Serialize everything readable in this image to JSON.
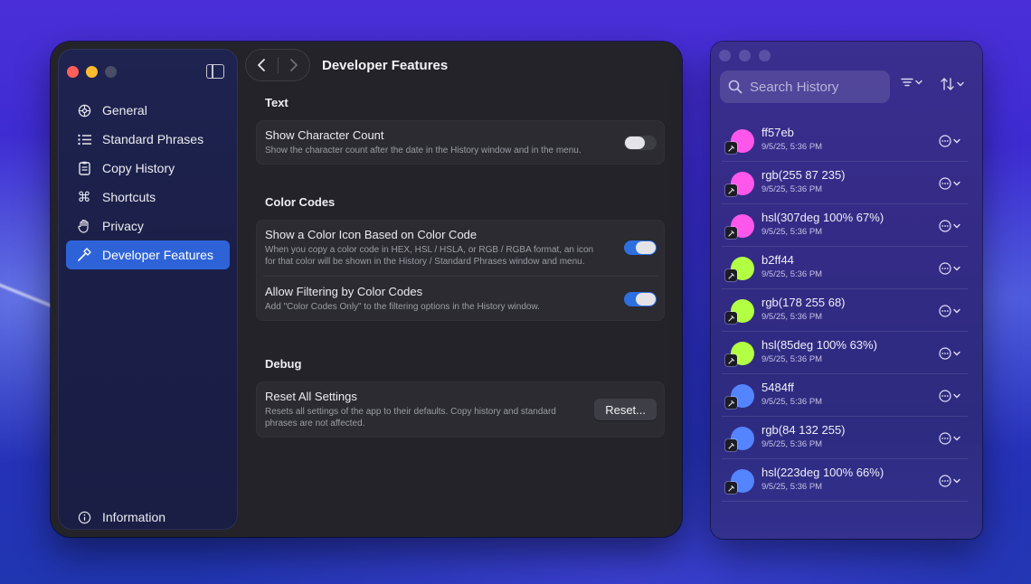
{
  "settings": {
    "sidebar": {
      "items": [
        {
          "label": "General",
          "icon": "gear-icon"
        },
        {
          "label": "Standard Phrases",
          "icon": "list-icon"
        },
        {
          "label": "Copy History",
          "icon": "clipboard-icon"
        },
        {
          "label": "Shortcuts",
          "icon": "command-icon"
        },
        {
          "label": "Privacy",
          "icon": "hand-icon"
        },
        {
          "label": "Developer Features",
          "icon": "hammer-icon",
          "active": true
        }
      ],
      "bottom_item": {
        "label": "Information",
        "icon": "info-icon"
      }
    },
    "title": "Developer Features",
    "sections": {
      "text": {
        "title": "Text",
        "show_char_count": {
          "title": "Show Character Count",
          "desc": "Show the character count after the date in the History window and in the menu.",
          "enabled": false
        }
      },
      "color_codes": {
        "title": "Color Codes",
        "color_icon": {
          "title": "Show a Color Icon Based on Color Code",
          "desc_line1": "When you copy a color code in HEX, HSL / HSLA, or RGB / RGBA format, an icon",
          "desc_line2": "for that color will be shown in the History / Standard Phrases window and menu.",
          "enabled": true
        },
        "filtering": {
          "title": "Allow Filtering by Color Codes",
          "desc": "Add \"Color Codes Only\" to the filtering options in the History window.",
          "enabled": true
        }
      },
      "debug": {
        "title": "Debug",
        "reset": {
          "title": "Reset All Settings",
          "desc_line1": "Resets all settings of the app to their defaults. Copy history and standard",
          "desc_line2": "phrases are not affected.",
          "button": "Reset..."
        }
      }
    }
  },
  "history": {
    "search_placeholder": "Search History",
    "items": [
      {
        "title": "ff57eb",
        "time": "9/5/25, 5:36 PM",
        "color": "#ff57eb"
      },
      {
        "title": "rgb(255 87 235)",
        "time": "9/5/25, 5:36 PM",
        "color": "#ff57eb"
      },
      {
        "title": "hsl(307deg 100% 67%)",
        "time": "9/5/25, 5:36 PM",
        "color": "#ff57eb"
      },
      {
        "title": "b2ff44",
        "time": "9/5/25, 5:36 PM",
        "color": "#b2ff44"
      },
      {
        "title": "rgb(178 255 68)",
        "time": "9/5/25, 5:36 PM",
        "color": "#b2ff44"
      },
      {
        "title": "hsl(85deg 100% 63%)",
        "time": "9/5/25, 5:36 PM",
        "color": "#b2ff44"
      },
      {
        "title": "5484ff",
        "time": "9/5/25, 5:36 PM",
        "color": "#5484ff"
      },
      {
        "title": "rgb(84 132 255)",
        "time": "9/5/25, 5:36 PM",
        "color": "#5484ff"
      },
      {
        "title": "hsl(223deg 100% 66%)",
        "time": "9/5/25, 5:36 PM",
        "color": "#5484ff"
      }
    ]
  }
}
